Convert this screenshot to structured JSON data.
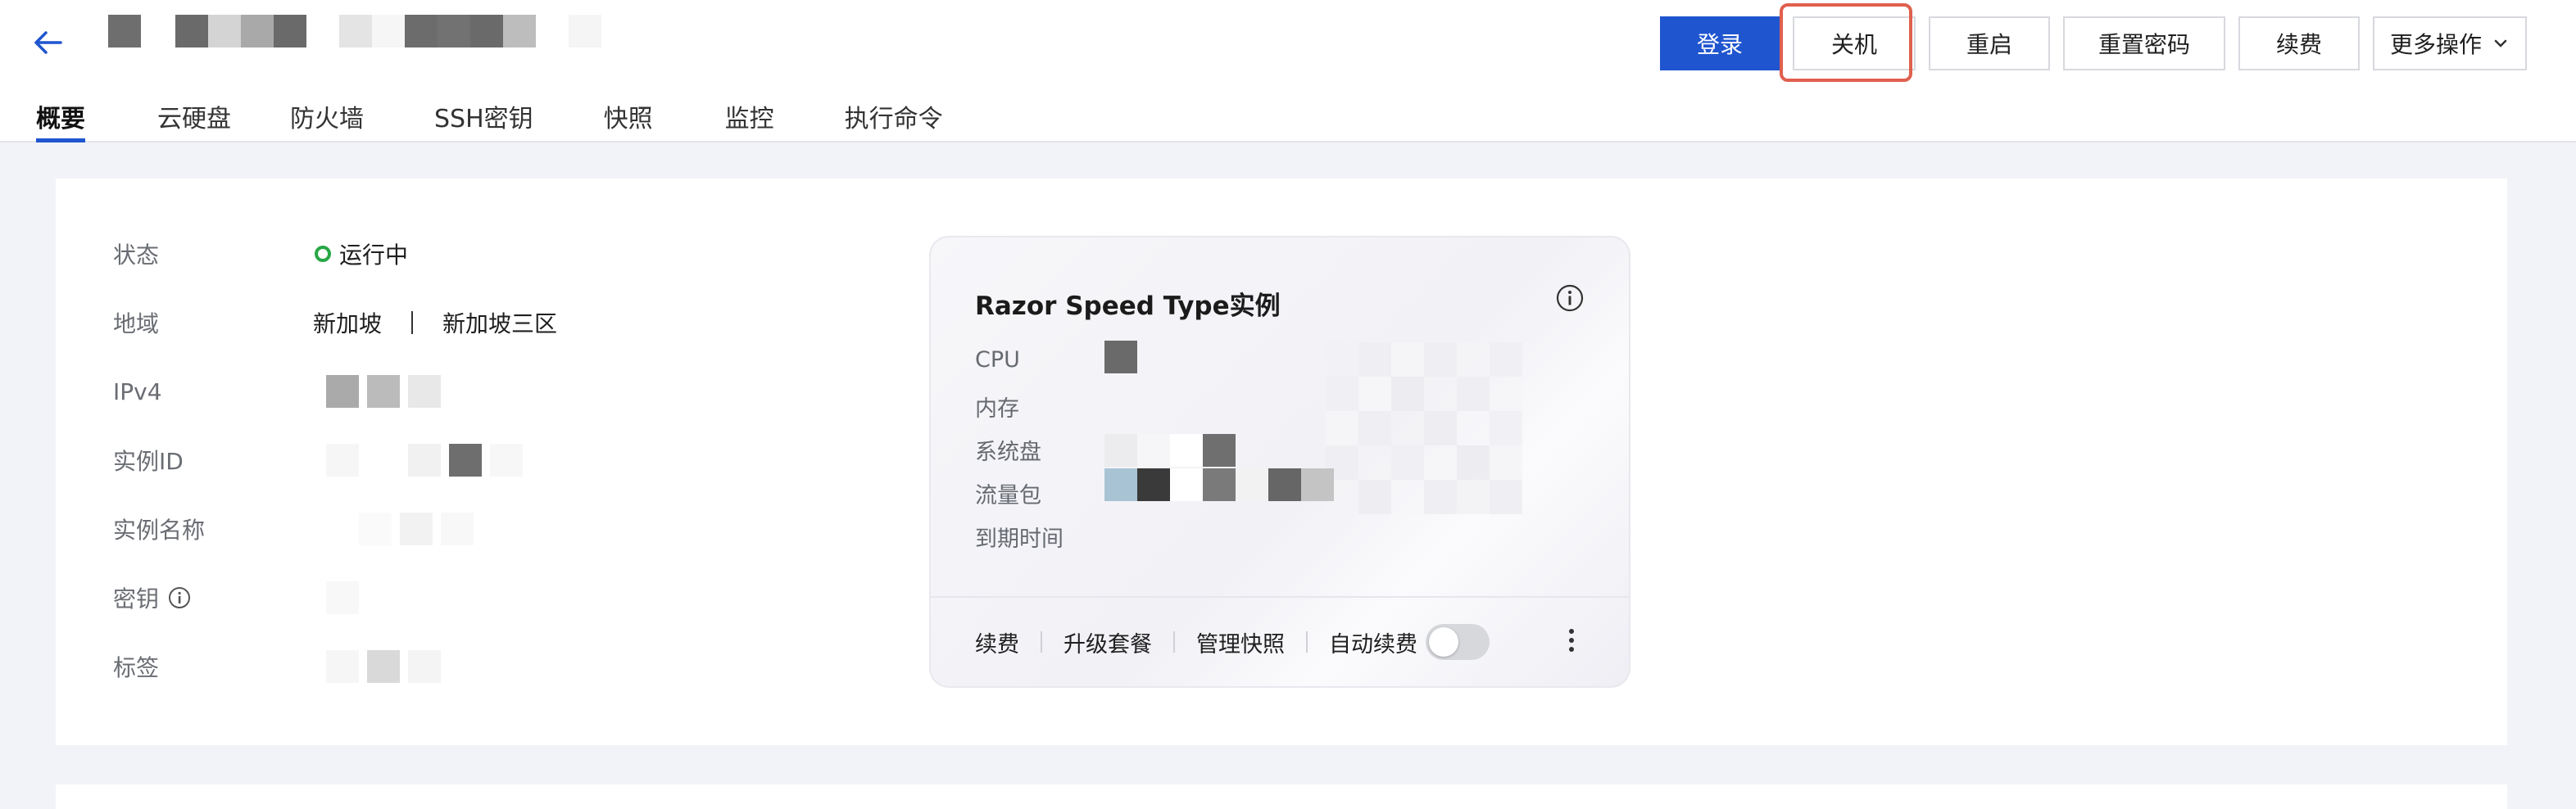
{
  "header": {
    "back_icon": "arrow-left-icon",
    "actions": {
      "login": "登录",
      "shutdown": "关机",
      "restart": "重启",
      "reset_password": "重置密码",
      "renew": "续费",
      "more": "更多操作"
    },
    "tabs": [
      "概要",
      "云硬盘",
      "防火墙",
      "SSH密钥",
      "快照",
      "监控",
      "执行命令"
    ],
    "active_tab": "概要"
  },
  "info": {
    "status_label": "状态",
    "status_value": "运行中",
    "region_label": "地域",
    "region_value": "新加坡",
    "zone_value": "新加坡三区",
    "ipv4_label": "IPv4",
    "instance_id_label": "实例ID",
    "instance_name_label": "实例名称",
    "key_label": "密钥",
    "tags_label": "标签"
  },
  "spec_card": {
    "title": "Razor Speed Type实例",
    "labels": [
      "CPU",
      "内存",
      "系统盘",
      "流量包",
      "到期时间"
    ],
    "footer": {
      "renew": "续费",
      "upgrade": "升级套餐",
      "snapshots": "管理快照",
      "auto_renew": "自动续费"
    },
    "auto_renew_on": false
  },
  "colors": {
    "primary": "#1f55cf",
    "highlight": "#e0604e",
    "status_running": "#28a745"
  }
}
